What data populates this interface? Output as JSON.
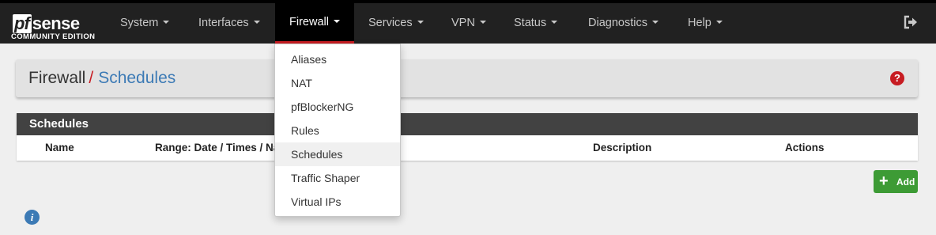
{
  "brand": {
    "logo_pf": "pf",
    "logo_sense": "sense",
    "logo_subtitle": "COMMUNITY EDITION"
  },
  "nav": {
    "items": [
      {
        "label": "System"
      },
      {
        "label": "Interfaces"
      },
      {
        "label": "Firewall",
        "active": true
      },
      {
        "label": "Services"
      },
      {
        "label": "VPN"
      },
      {
        "label": "Status"
      },
      {
        "label": "Diagnostics"
      },
      {
        "label": "Help"
      }
    ],
    "logout_icon": "sign-out-icon"
  },
  "firewall_menu": {
    "items": [
      "Aliases",
      "NAT",
      "pfBlockerNG",
      "Rules",
      "Schedules",
      "Traffic Shaper",
      "Virtual IPs"
    ],
    "highlighted": "Schedules"
  },
  "breadcrumb": {
    "root": "Firewall",
    "separator": "/",
    "current": "Schedules",
    "help_icon": "?"
  },
  "schedules_panel": {
    "title": "Schedules",
    "columns": [
      "Name",
      "Range: Date / Times / Name",
      "Description",
      "Actions"
    ]
  },
  "actions": {
    "add_label": "Add",
    "add_icon": "+"
  },
  "info_icon": "i",
  "colors": {
    "navbar": "#212121",
    "accent_red": "#c71c22",
    "link_blue": "#3c7ab5",
    "add_green": "#3d9b35",
    "panel_head": "#424242"
  }
}
